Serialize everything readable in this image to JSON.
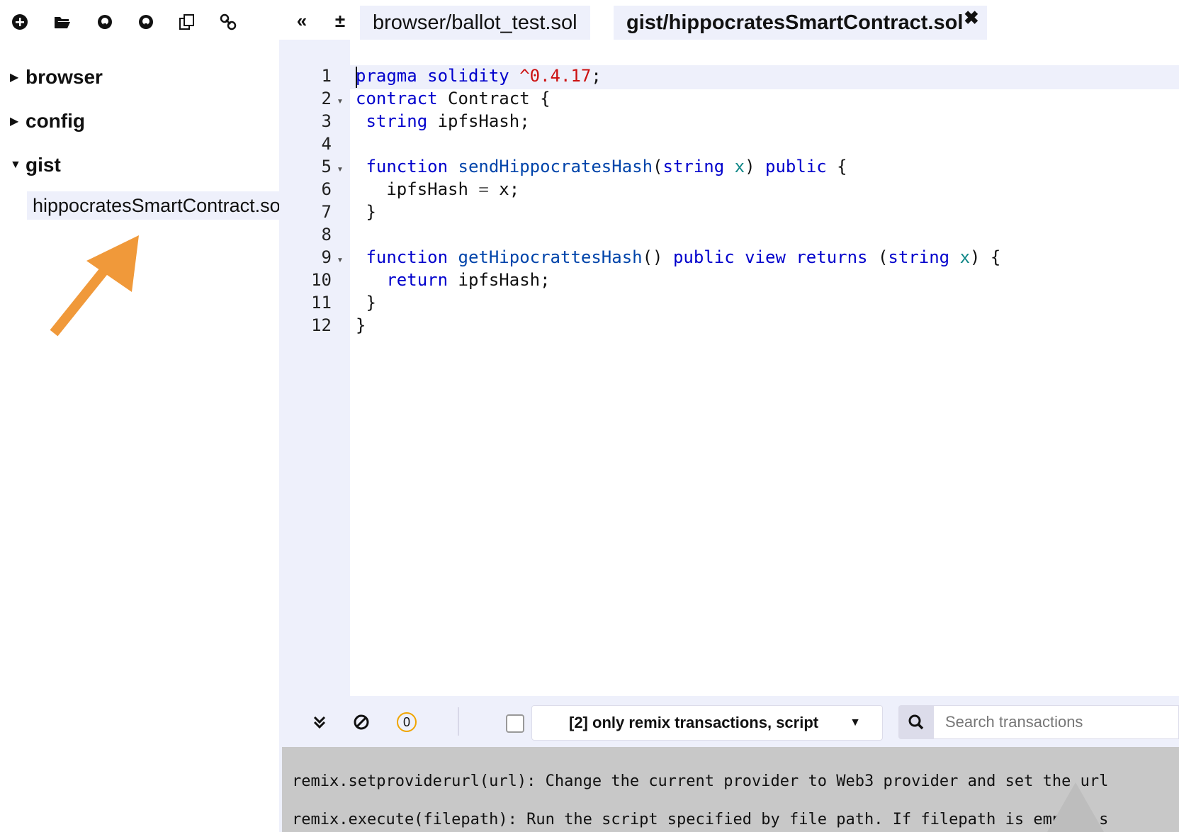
{
  "file_toolbar": {
    "icons": [
      "create-new-file-icon",
      "open-folder-icon",
      "publish-gist-icon",
      "update-gist-icon",
      "copy-to-other-instance-icon",
      "connect-localhost-icon"
    ]
  },
  "file_tree": {
    "folders": [
      {
        "label": "browser",
        "expanded": false
      },
      {
        "label": "config",
        "expanded": false
      },
      {
        "label": "gist",
        "expanded": true
      }
    ],
    "selected_file": "hippocratesSmartContract.sol"
  },
  "tabs": [
    {
      "label": "browser/ballot_test.sol",
      "active": false
    },
    {
      "label": "gist/hippocratesSmartContract.sol",
      "active": true
    }
  ],
  "tab_bar_buttons": {
    "collapse": "«",
    "zoom": "±",
    "close": "✖"
  },
  "editor": {
    "line_numbers": [
      "1",
      "2",
      "3",
      "4",
      "5",
      "6",
      "7",
      "8",
      "9",
      "10",
      "11",
      "12"
    ]
  },
  "terminal": {
    "pending_count": "0",
    "filter_value": "[2] only remix transactions, script",
    "search_placeholder": "Search transactions",
    "output_lines": [
      "remix.setproviderurl(url): Change the current provider to Web3 provider and set the url",
      "remix.execute(filepath): Run the script specified by file path. If filepath is empty, s"
    ]
  },
  "colors": {
    "keyword": "#0000cc",
    "number": "#cc1111",
    "panel_bg": "#eef0fb",
    "annotation_arrow": "#f0993a",
    "pending_badge": "#f0a500"
  }
}
